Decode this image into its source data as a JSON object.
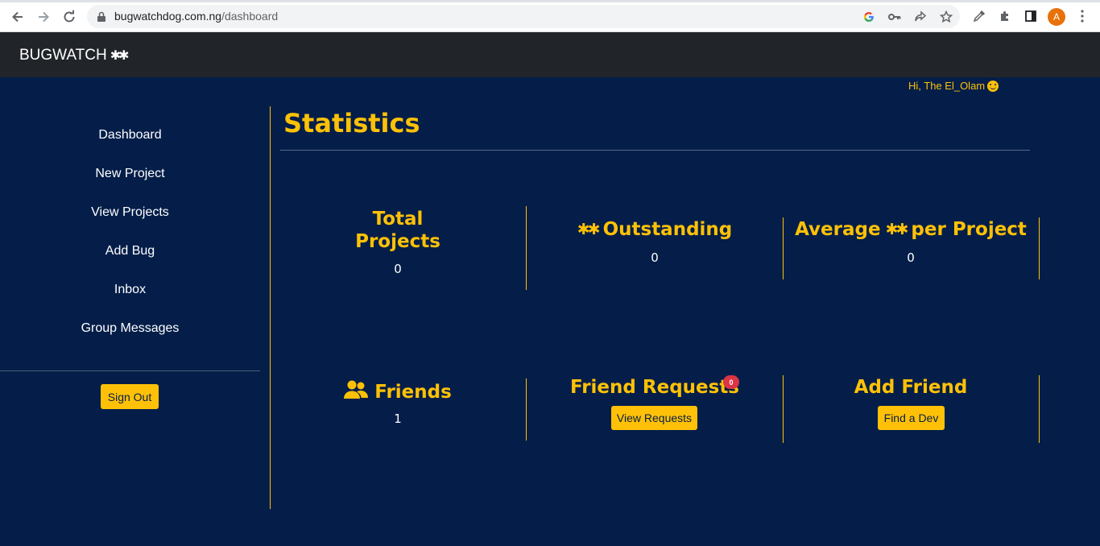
{
  "browser": {
    "url_domain": "bugwatchdog.com.ng",
    "url_path": "/dashboard",
    "profile_initial": "A"
  },
  "navbar": {
    "brand": "BUGWATCH",
    "brand_glyph": "✱✱"
  },
  "greeting": "Hi, The El_Olam",
  "sidebar": {
    "items": [
      {
        "label": "Dashboard"
      },
      {
        "label": "New Project"
      },
      {
        "label": "View Projects"
      },
      {
        "label": "Add Bug"
      },
      {
        "label": "Inbox"
      },
      {
        "label": "Group Messages"
      }
    ],
    "signout_label": "Sign Out"
  },
  "main": {
    "title": "Statistics",
    "stats": [
      {
        "title_line1": "Total",
        "title_line2": "Projects",
        "value": "0"
      },
      {
        "title": "Outstanding",
        "value": "0"
      },
      {
        "title_pre": "Average",
        "title_post": "per Project",
        "value": "0"
      }
    ],
    "social": {
      "friends": {
        "title": "Friends",
        "value": "1"
      },
      "requests": {
        "title": "Friend Requests",
        "badge": "0",
        "button": "View Requests"
      },
      "add": {
        "title": "Add Friend",
        "button": "Find a Dev"
      }
    }
  },
  "colors": {
    "background": "#041e49",
    "navbar": "#212529",
    "accent": "#ffc107",
    "badge": "#dc3545"
  }
}
